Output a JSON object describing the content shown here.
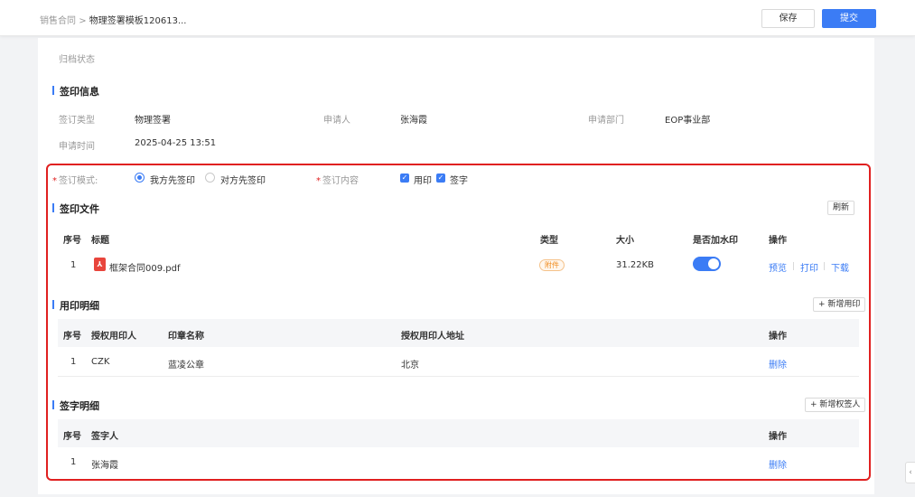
{
  "header": {
    "breadcrumb_parent": "销售合同",
    "breadcrumb_sep": ">",
    "breadcrumb_current": "物理签署模板120613...",
    "save_label": "保存",
    "submit_label": "提交"
  },
  "archive": {
    "label": "归档状态"
  },
  "sign_info": {
    "title": "签印信息",
    "type_label": "签订类型",
    "type_value": "物理签署",
    "applicant_label": "申请人",
    "applicant_value": "张海霞",
    "dept_label": "申请部门",
    "dept_value": "EOP事业部",
    "time_label": "申请时间",
    "time_value": "2025-04-25 13:51"
  },
  "mode": {
    "label": "签订模式:",
    "options": [
      "我方先签印",
      "对方先签印"
    ],
    "selected": "我方先签印"
  },
  "content": {
    "label": "签订内容",
    "options": [
      "用印",
      "签字"
    ]
  },
  "files": {
    "title": "签印文件",
    "refresh_label": "刷新",
    "columns": [
      "序号",
      "标题",
      "类型",
      "大小",
      "是否加水印",
      "操作"
    ],
    "rows": [
      {
        "no": "1",
        "title": "框架合同009.pdf",
        "type": "附件",
        "size": "31.22KB",
        "watermark": true
      }
    ],
    "actions": [
      "预览",
      "打印",
      "下载"
    ]
  },
  "seal": {
    "title": "用印明细",
    "add_label": "+ 新增用印",
    "columns": [
      "序号",
      "授权用印人",
      "印章名称",
      "授权用印人地址",
      "操作"
    ],
    "rows": [
      {
        "no": "1",
        "person": "CZK",
        "seal_name": "蓝凌公章",
        "address": "北京",
        "action": "删除"
      }
    ]
  },
  "signer": {
    "title": "签字明细",
    "add_label": "+ 新增权签人",
    "columns": [
      "序号",
      "签字人",
      "操作"
    ],
    "rows": [
      {
        "no": "1",
        "name": "张海霞",
        "action": "删除"
      }
    ]
  },
  "colors": {
    "primary": "#3b7cf5",
    "highlight": "#e02020",
    "pdf": "#e8453c"
  },
  "icons": {
    "file": "pdf-icon",
    "collapse": "chevron-left-icon"
  }
}
